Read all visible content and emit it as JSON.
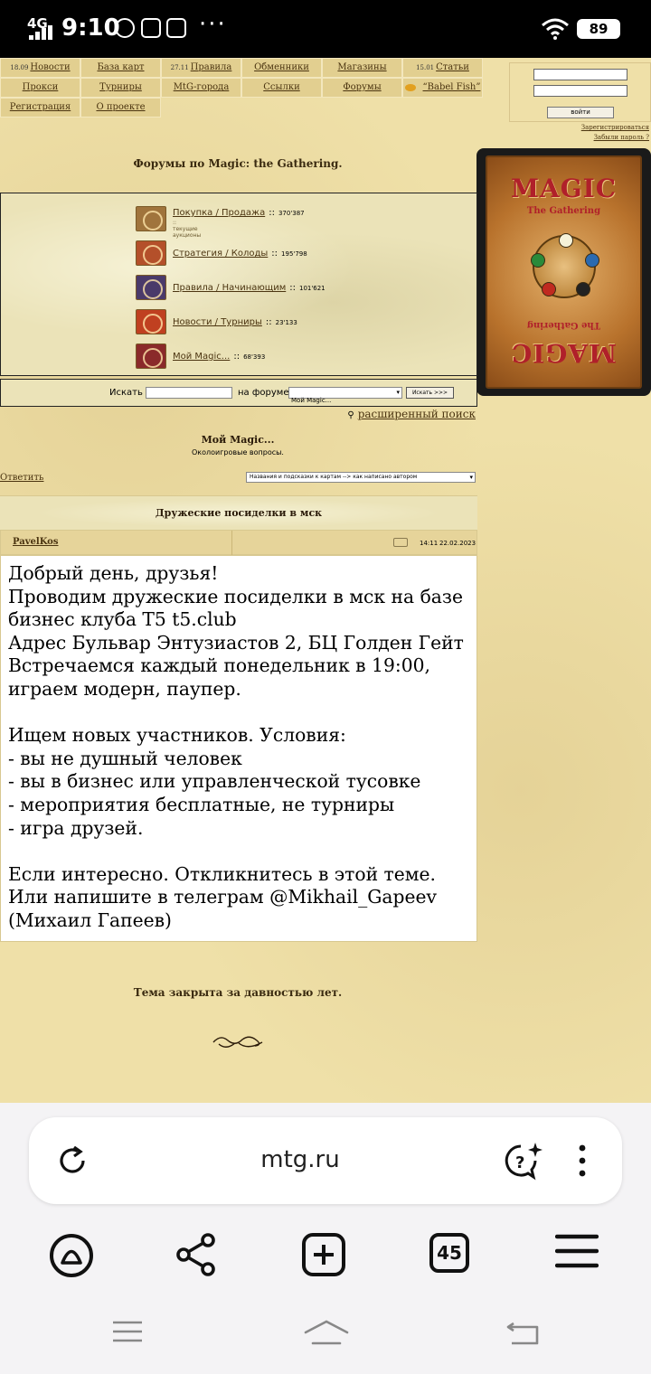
{
  "status_bar": {
    "network": "4G",
    "time": "9:10",
    "battery": "89"
  },
  "nav": {
    "row1": [
      {
        "date": "18.09",
        "label": "Новости"
      },
      {
        "date": "",
        "label": "База карт"
      },
      {
        "date": "27.11",
        "label": "Правила"
      },
      {
        "date": "",
        "label": "Обменники"
      },
      {
        "date": "",
        "label": "Магазины"
      },
      {
        "date": "15.01",
        "label": "Статьи"
      }
    ],
    "row2": [
      {
        "label": "Прокси"
      },
      {
        "label": "Турниры"
      },
      {
        "label": "MtG-города"
      },
      {
        "label": "Ссылки"
      },
      {
        "label": "Форумы"
      },
      {
        "label": "“Babel Fish”"
      }
    ],
    "row3": [
      {
        "label": "Регистрация"
      },
      {
        "label": "О проекте"
      }
    ]
  },
  "login": {
    "button": "войти",
    "register_link": "Зарегистрироваться",
    "forgot_link": "Забыли пароль ?"
  },
  "card": {
    "logo": "MAGIC",
    "subtitle": "The Gathering"
  },
  "forums": {
    "title": "Форумы по Magic: the Gathering.",
    "items": [
      {
        "label": "Покупка / Продажа",
        "count": "370'387",
        "sub": ":: текущие аукционы",
        "color": "#a0743c"
      },
      {
        "label": "Стратегия / Колоды",
        "count": "195'798",
        "sub": "",
        "color": "#b4502a"
      },
      {
        "label": "Правила / Начинающим",
        "count": "101'621",
        "sub": "",
        "color": "#4a3a6a"
      },
      {
        "label": "Новости / Турниры",
        "count": "23'133",
        "sub": "",
        "color": "#c04020"
      },
      {
        "label": "Мой Magic...",
        "count": "68'393",
        "sub": "",
        "color": "#8a2a2a"
      }
    ],
    "separator": "::"
  },
  "search": {
    "label": "Искать",
    "in_forum": "на форуме",
    "forum_selected": "Мой Magic...",
    "button": "Искать >>>",
    "advanced": "расширенный поиск"
  },
  "subforum": {
    "title": "Мой Magic...",
    "description": "Околоигровые вопросы."
  },
  "reply_link": "Ответить",
  "sort_selected": "Названия и подсказки к картам --> как написано автором",
  "topic": {
    "title": "Дружеские посиделки в мск",
    "author": "PavelKos",
    "time": "14:11",
    "date": "22.02.2023",
    "body": [
      "Добрый день, друзья!",
      "Проводим дружеские посиделки в мск на базе",
      "бизнес клуба T5 t5.club",
      "Адрес Бульвар Энтузиастов 2, БЦ Голден Гейт",
      "Встречаемся каждый понедельник в 19:00,",
      "играем модерн, паупер.",
      "",
      "Ищем новых участников. Условия:",
      "- вы не душный человек",
      "- вы в бизнес или управленческой тусовке",
      "- мероприятия бесплатные, не турниры",
      "- игра друзей.",
      "",
      "Если интересно. Откликнитесь в этой теме.",
      "Или напишите в телеграм @Mikhail_Gapeev",
      "(Михаил Гапеев)"
    ]
  },
  "closed_notice": "Тема закрыта за давностью лет.",
  "browser": {
    "url": "mtg.ru",
    "tabs_count": "45"
  }
}
